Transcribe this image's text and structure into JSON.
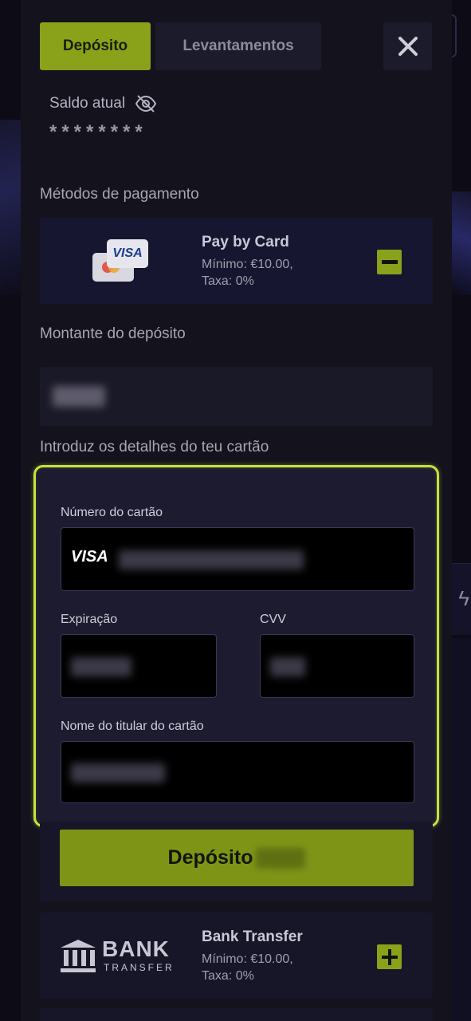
{
  "tabs": {
    "deposit": "Depósito",
    "withdrawals": "Levantamentos"
  },
  "balance": {
    "label": "Saldo atual",
    "masked_value": "********"
  },
  "payment_methods_label": "Métodos de pagamento",
  "methods": [
    {
      "name": "Pay by Card",
      "min": "Mínimo: €10.00,",
      "fee": "Taxa: 0%",
      "logo_text": "VISA",
      "toggle": "minus-icon"
    },
    {
      "name": "Bank Transfer",
      "min": "Mínimo: €10.00,",
      "fee": "Taxa: 0%",
      "logo_main": "BANK",
      "logo_sub": "TRANSFER",
      "toggle": "plus-icon"
    }
  ],
  "amount_label": "Montante do depósito",
  "card_details_label": "Introduz os detalhes do teu cartão",
  "card_form": {
    "number_label": "Número do cartão",
    "card_brand": "VISA",
    "expiry_label": "Expiração",
    "cvv_label": "CVV",
    "holder_label": "Nome do titular do cartão"
  },
  "deposit_button": "Depósito",
  "colors": {
    "accent": "#8aa11a",
    "highlight_border": "#c6e23c",
    "panel": "#13121d"
  }
}
